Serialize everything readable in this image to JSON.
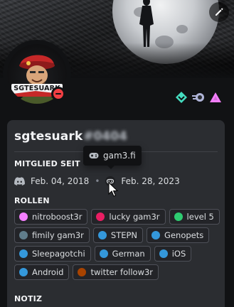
{
  "profile": {
    "username": "sgtesuark",
    "discriminator": "#0404",
    "avatar_text": "SGTESUARK",
    "status": "do-not-disturb",
    "status_color": "#f23f43"
  },
  "badges": [
    {
      "name": "hypesquad-balance-icon",
      "color": "#45ddc0"
    },
    {
      "name": "nitro-orb-icon",
      "color": "#b0b5d9"
    },
    {
      "name": "nitro-boost-triangle-icon",
      "color": "#f47fff"
    }
  ],
  "sections": {
    "member_since": "MITGLIED SEIT",
    "roles": "ROLLEN",
    "note": "NOTIZ"
  },
  "member_since": {
    "discord_date": "Feb. 04, 2018",
    "server_date": "Feb. 28, 2023"
  },
  "tooltip": {
    "label": "gam3.fi"
  },
  "roles": [
    {
      "label": "nitroboost3r",
      "color": "#f47fff"
    },
    {
      "label": "lucky gam3r",
      "color": "#e91e63"
    },
    {
      "label": "level 5",
      "color": "#2ecc71"
    },
    {
      "label": "fimily gam3r",
      "color": "#607d8b"
    },
    {
      "label": "STEPN",
      "color": "#3498db"
    },
    {
      "label": "Genopets",
      "color": "#3498db"
    },
    {
      "label": "Sleepagotchi",
      "color": "#3498db"
    },
    {
      "label": "German",
      "color": "#3498db"
    },
    {
      "label": "iOS",
      "color": "#3498db"
    },
    {
      "label": "Android",
      "color": "#3498db"
    },
    {
      "label": "twitter follow3r",
      "color": "#a84300"
    }
  ]
}
